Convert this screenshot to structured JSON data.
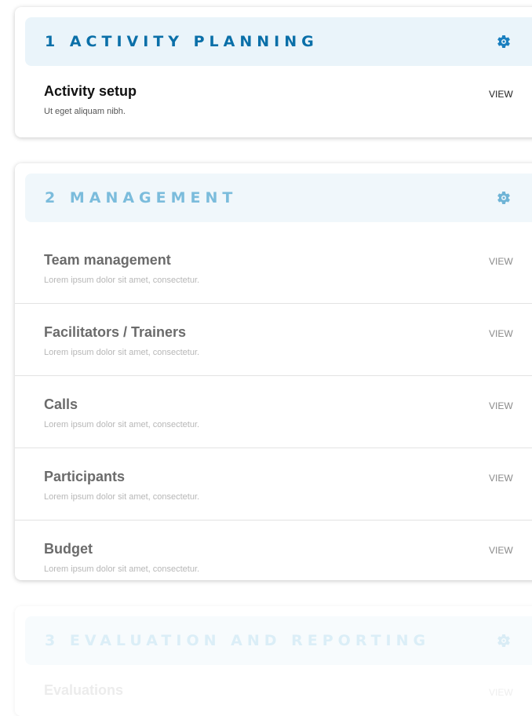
{
  "sections": [
    {
      "title": "1 ACTIVITY PLANNING",
      "icon": "gear-icon",
      "items": [
        {
          "title": "Activity setup",
          "description": "Ut eget aliquam nibh.",
          "action": "VIEW"
        }
      ]
    },
    {
      "title": "2 MANAGEMENT",
      "icon": "gear-icon",
      "items": [
        {
          "title": "Team management",
          "description": "Lorem ipsum dolor sit amet, consectetur.",
          "action": "VIEW"
        },
        {
          "title": "Facilitators / Trainers",
          "description": "Lorem ipsum dolor sit amet, consectetur.",
          "action": "VIEW"
        },
        {
          "title": "Calls",
          "description": "Lorem ipsum dolor sit amet, consectetur.",
          "action": "VIEW"
        },
        {
          "title": "Participants",
          "description": "Lorem ipsum dolor sit amet, consectetur.",
          "action": "VIEW"
        },
        {
          "title": "Budget",
          "description": "Lorem ipsum dolor sit amet, consectetur.",
          "action": "VIEW"
        }
      ]
    },
    {
      "title": "3 EVALUATION AND REPORTING",
      "icon": "gear-icon",
      "items": [
        {
          "title": "Evaluations",
          "action": "VIEW"
        }
      ]
    }
  ],
  "colors": {
    "active_title": "#0a6fa8",
    "secondary_title": "#7bbcdc",
    "faded_title": "#dbeef7",
    "header_bg": "#eaf4fa"
  }
}
